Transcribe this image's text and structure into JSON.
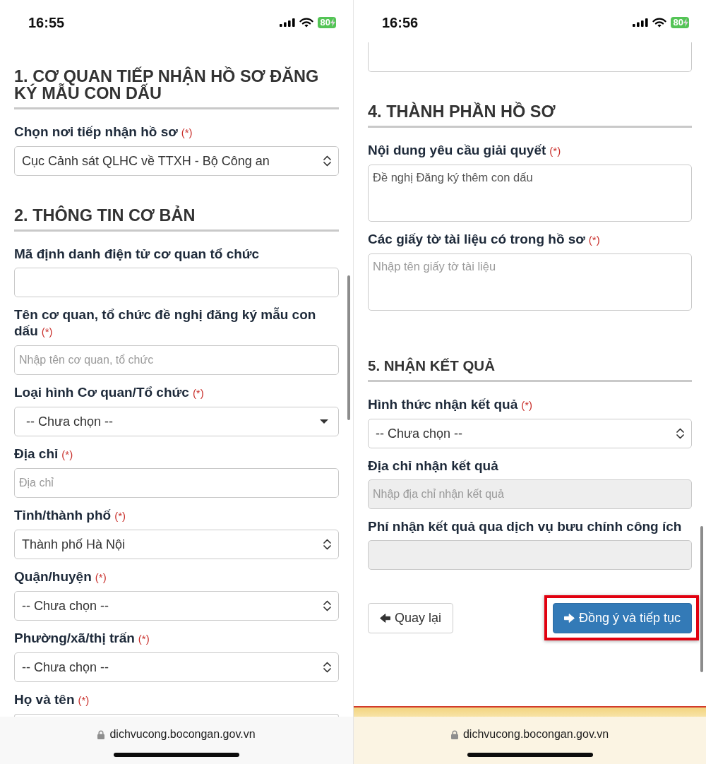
{
  "screens": [
    {
      "status_bar": {
        "time": "16:55",
        "battery": "80"
      },
      "content": [
        {
          "kind": "heading",
          "text": "1. CƠ QUAN TIẾP NHẬN HỒ SƠ ĐĂNG KÝ MẪU CON DẤU"
        },
        {
          "kind": "select",
          "label": "Chọn nơi tiếp nhận hồ sơ",
          "required_mark": "(*)",
          "value": "Cục Cảnh sát QLHC về TTXH - Bộ Công an",
          "disabled": false
        },
        {
          "kind": "heading",
          "text": "2. THÔNG TIN CƠ BẢN"
        },
        {
          "kind": "input",
          "label": "Mã định danh điện tử cơ quan tổ chức",
          "disabled": false
        },
        {
          "kind": "input",
          "label": "Tên cơ quan, tổ chức đề nghị đăng ký mẫu con dấu",
          "required_mark": "(*)",
          "placeholder": "Nhập tên cơ quan, tổ chức",
          "disabled": false
        },
        {
          "kind": "dropdown",
          "label": "Loại hình Cơ quan/Tổ chức",
          "required_mark": "(*)",
          "value": "-- Chưa chọn --",
          "disabled": false
        },
        {
          "kind": "input",
          "label": "Địa chỉ",
          "required_mark": "(*)",
          "placeholder": "Địa chỉ",
          "disabled": false
        },
        {
          "kind": "select",
          "label": "Tỉnh/thành phố",
          "required_mark": "(*)",
          "value": "Thành phố Hà Nội",
          "disabled": false
        },
        {
          "kind": "select",
          "label": "Quận/huyện",
          "required_mark": "(*)",
          "value": "-- Chưa chọn --",
          "disabled": false
        },
        {
          "kind": "select",
          "label": "Phường/xã/thị trấn",
          "required_mark": "(*)",
          "value": "-- Chưa chọn --",
          "disabled": false
        },
        {
          "kind": "stub",
          "label": "Họ và tên",
          "required_mark": "(*)"
        }
      ],
      "address_bar": {
        "url": "dichvucong.bocongan.gov.vn"
      }
    },
    {
      "status_bar": {
        "time": "16:56",
        "battery": "80"
      },
      "content": [
        {
          "kind": "tail"
        },
        {
          "kind": "heading",
          "text": "4. THÀNH PHẦN HỒ SƠ"
        },
        {
          "kind": "textarea",
          "label": "Nội dung yêu cầu giải quyết",
          "required_mark": "(*)",
          "value": "Đề nghị Đăng ký thêm con dấu",
          "disabled": false
        },
        {
          "kind": "textarea",
          "label": "Các giấy tờ tài liệu có trong hồ sơ",
          "required_mark": "(*)",
          "placeholder": "Nhập tên giấy tờ tài liệu",
          "disabled": false
        },
        {
          "kind": "subheading",
          "text": "5. NHẬN KẾT QUẢ"
        },
        {
          "kind": "select",
          "label": "Hình thức nhận kết quả",
          "required_mark": "(*)",
          "value": "-- Chưa chọn --",
          "disabled": false
        },
        {
          "kind": "input",
          "label": "Địa chỉ nhận kết quả",
          "placeholder": "Nhập địa chỉ nhận kết quả",
          "disabled": true
        },
        {
          "kind": "input",
          "label": "Phí nhận kết quả qua dịch vụ bưu chính công ích",
          "disabled": true
        },
        {
          "kind": "actions",
          "buttons": [
            {
              "kind": "back",
              "label": "Quay lại",
              "highlighted": false
            },
            {
              "kind": "next",
              "label": "Đồng ý và tiếp tục",
              "highlighted": true
            }
          ]
        }
      ],
      "footer_band": true,
      "address_bar": {
        "url": "dichvucong.bocongan.gov.vn"
      }
    }
  ]
}
